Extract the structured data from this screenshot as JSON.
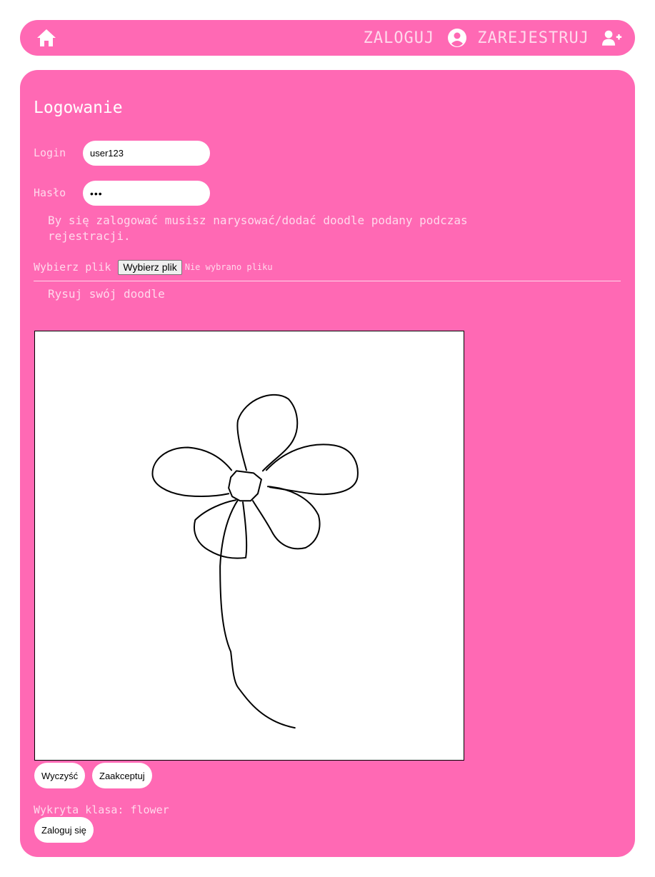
{
  "nav": {
    "home_icon": "home-icon",
    "login_label": "ZALOGUJ",
    "login_icon": "user-circle-icon",
    "register_label": "ZAREJESTRUJ",
    "register_icon": "user-plus-icon"
  },
  "form": {
    "title": "Logowanie",
    "login_label": "Login",
    "login_value": "user123",
    "password_label": "Hasło",
    "password_value": "•••",
    "info": "By się zalogować musisz narysować/dodać doodle podany podczas rejestracji.",
    "file_label": "Wybierz plik",
    "file_button": "Wybierz plik",
    "file_status": "Nie wybrano pliku",
    "draw_title": "Rysuj swój doodle",
    "clear_button": "Wyczyść",
    "accept_button": "Zaakceptuj",
    "detected_class": "Wykryta klasa: flower",
    "submit_button": "Zaloguj się"
  },
  "colors": {
    "accent": "#ff69b4",
    "muted_text": "#ffd9ec",
    "background": "#ffffff"
  }
}
